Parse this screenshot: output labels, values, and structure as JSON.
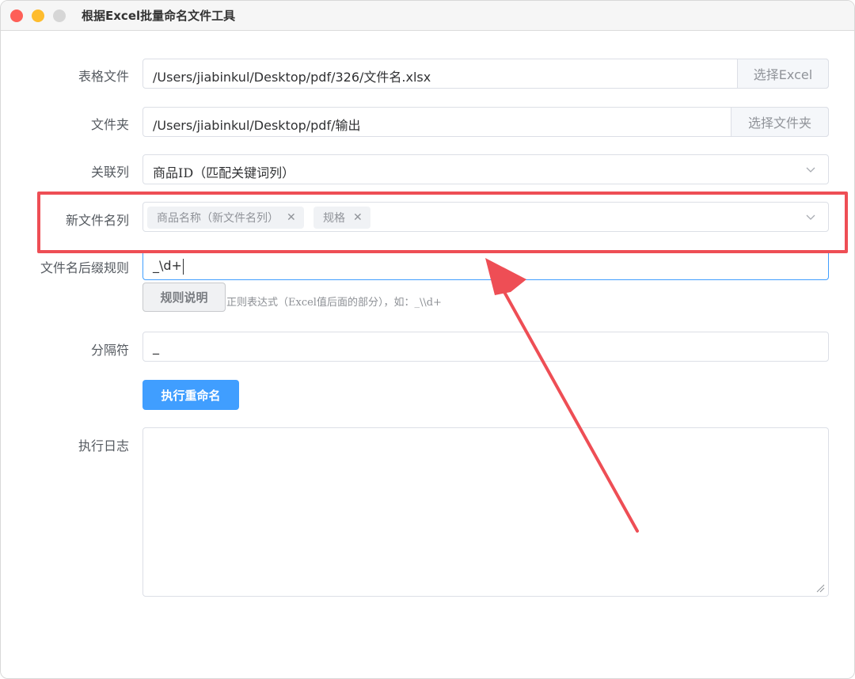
{
  "window": {
    "title": "根据Excel批量命名文件工具"
  },
  "form": {
    "excel": {
      "label": "表格文件",
      "value": "/Users/jiabinkul/Desktop/pdf/326/文件名.xlsx",
      "button": "选择Excel"
    },
    "folder": {
      "label": "文件夹",
      "value": "/Users/jiabinkul/Desktop/pdf/输出",
      "button": "选择文件夹"
    },
    "link_column": {
      "label": "关联列",
      "value": "商品ID（匹配关键词列）"
    },
    "new_name_columns": {
      "label": "新文件名列",
      "tags": [
        "商品名称（新文件名列）",
        "规格"
      ]
    },
    "suffix_rule": {
      "label": "文件名后缀规则",
      "value": "_\\d+",
      "help_button": "规则说明",
      "hint": "正则表达式（Excel值后面的部分），如：_\\\\d+"
    },
    "separator": {
      "label": "分隔符",
      "value": "_"
    },
    "run_button": "执行重命名",
    "log": {
      "label": "执行日志",
      "value": ""
    }
  },
  "colors": {
    "primary": "#409eff",
    "annotation_red": "#ee4e55",
    "close": "#fe5f57",
    "minimize": "#febc2e",
    "maximize": "#d6d6d6"
  },
  "icons": {
    "tag_remove": "close-icon",
    "select_arrow": "chevron-down-icon",
    "textarea_resize": "resize-grip-icon"
  }
}
